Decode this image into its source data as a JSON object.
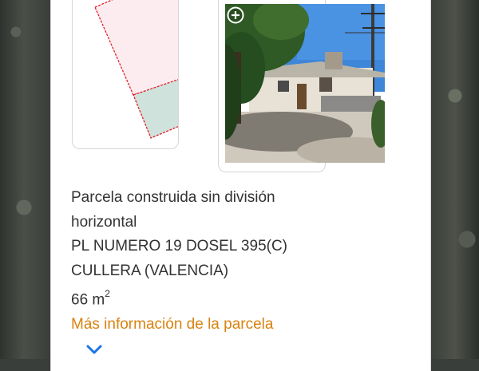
{
  "parcel": {
    "type_line1": "Parcela construida sin división",
    "type_line2": "horizontal",
    "address": "PL NUMERO 19 DOSEL 395(C)",
    "municipality": "CULLERA (VALENCIA)",
    "area_value": "66 m",
    "area_unit_exp": "2",
    "more_info_link": "Más información de la parcela"
  },
  "icons": {
    "zoom": "zoom-in-icon",
    "expand": "chevron-down-icon"
  },
  "colors": {
    "link": "#d9820f",
    "chevron": "#1a73e8",
    "plot_outline": "#e0202a",
    "plot_fill": "#fdecef",
    "building_fill": "#cfe2dc"
  }
}
